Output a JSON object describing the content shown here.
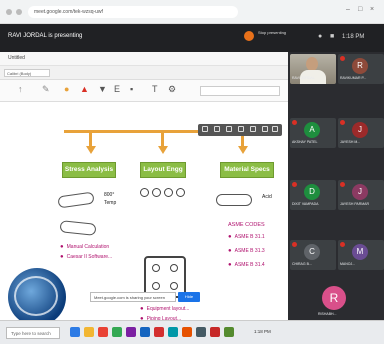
{
  "browser": {
    "url": "meet.google.com/tek-wzsq-uwf",
    "window_controls": [
      "–",
      "□",
      "×"
    ]
  },
  "presenting": {
    "text": "RAVI JORDAL is presenting",
    "stop_text": "Stop presenting",
    "clock": "1:18 PM"
  },
  "slide": {
    "tab_label": "Untitled",
    "font_select": "Calibri (Body)",
    "boxes": [
      "Stress Analysis",
      "Layout Engg",
      "Material Specs"
    ],
    "temp_value": "800°",
    "temp_label": "Temp",
    "acid_label": "Acid",
    "stress_bullets": [
      "Manual Calculation",
      "Caesar II Software..."
    ],
    "layout_bullets": [
      "Equipment layout...",
      "Piping Layout..."
    ],
    "asme_title": "ASME CODES",
    "asme_items": [
      "ASME B 31.1",
      "ASME B 31.3",
      "ASME B 31.4"
    ],
    "bottom_input": "Meet.google.com is sharing your screen",
    "hide_button": "Hide"
  },
  "taskbar": {
    "search_placeholder": "Type here to search",
    "clock": "1:18 PM",
    "icon_colors": [
      "#2d7be5",
      "#f2b632",
      "#e94235",
      "#34a853",
      "#7b1fa2",
      "#1565c0",
      "#d32f2f",
      "#0097a7",
      "#e65100",
      "#455a64",
      "#c62828",
      "#558b2f"
    ]
  },
  "participants": [
    {
      "initial": "",
      "name": "RAVI JORDAL",
      "color": "#000000",
      "video": true
    },
    {
      "initial": "R",
      "name": "RAVIKUMAR P...",
      "color": "#8e4a3a",
      "video": false
    },
    {
      "initial": "A",
      "name": "AKSHAY PATEL",
      "color": "#1e8e3e",
      "video": false
    },
    {
      "initial": "J",
      "name": "JAYESH M...",
      "color": "#9c2a2a",
      "video": false
    },
    {
      "initial": "D",
      "name": "DIXIT VAMPADA",
      "color": "#1e8e3e",
      "video": false
    },
    {
      "initial": "J",
      "name": "JAYESH PARMAR",
      "color": "#8b3a62",
      "video": false
    },
    {
      "initial": "C",
      "name": "CHIRAG B...",
      "color": "#5f6368",
      "video": false
    },
    {
      "initial": "M",
      "name": "MANOJ...",
      "color": "#6a4c93",
      "video": false
    },
    {
      "initial": "R",
      "name": "RISHABH...",
      "color": "#d9508a",
      "video": false
    }
  ]
}
